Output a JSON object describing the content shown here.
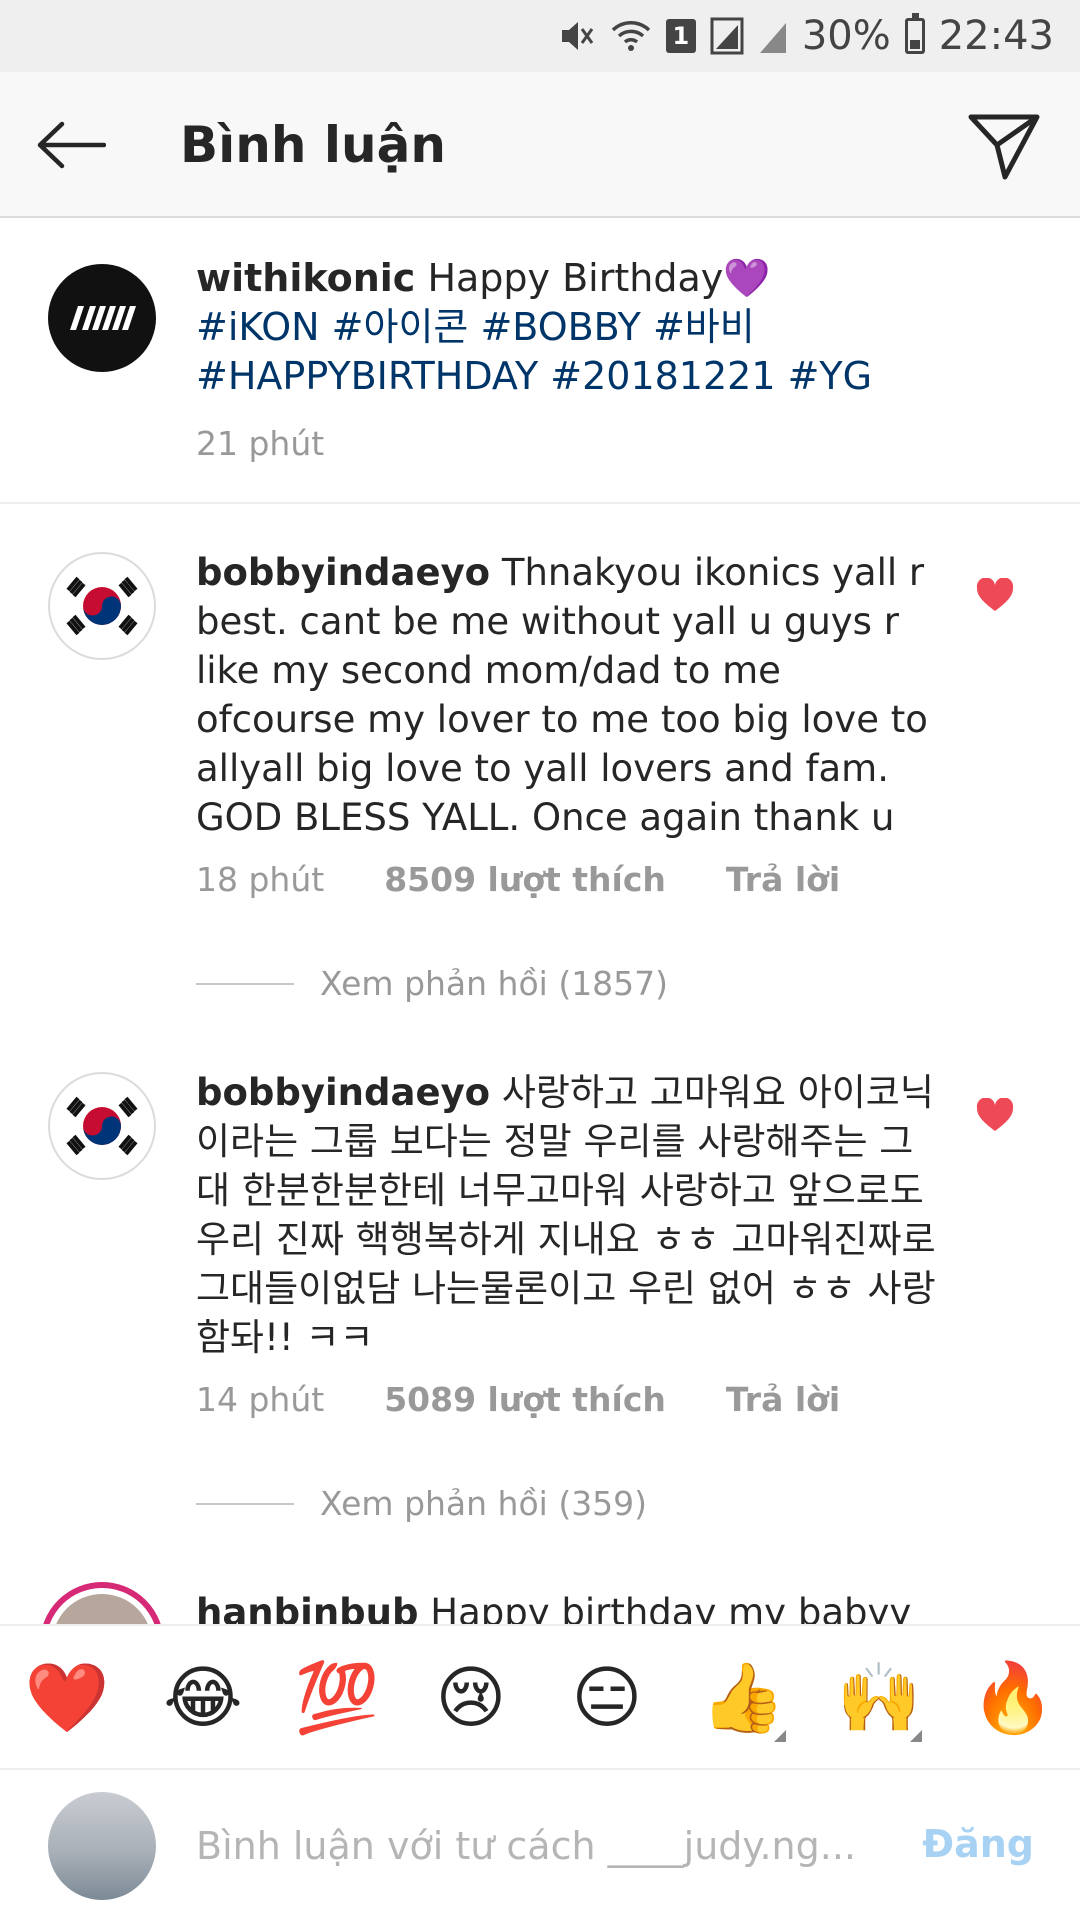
{
  "status_bar": {
    "battery": "30%",
    "sim_slot": "1",
    "time": "22:43"
  },
  "header": {
    "title": "Bình luận"
  },
  "caption": {
    "username": "withikonic",
    "text": "Happy Birthday💜",
    "hashtags": "#iKON #아이콘 #BOBBY #바비 #HAPPYBIRTHDAY #20181221 #YG",
    "time": "21 phút"
  },
  "comments": [
    {
      "username": "bobbyindaeyo",
      "text": "Thnakyou ikonics yall r best. cant be me without yall u guys r like my second mom/dad to me ofcourse my lover to me too big love to allyall big love to yall lovers and fam. GOD BLESS YALL. Once again thank u",
      "time": "18 phút",
      "likes": "8509 lượt thích",
      "reply": "Trả lời",
      "view_replies": "Xem phản hồi (1857)"
    },
    {
      "username": "bobbyindaeyo",
      "text": "사랑하고 고마워요 아이코닉 이라는 그룹 보다는 정말 우리를 사랑해주는 그대 한분한분한테 너무고마워 사랑하고 앞으로도 우리 진짜 핵행복하게 지내요 ㅎㅎ 고마워진짜로 그대들이없담 나는물론이고 우린 없어 ㅎㅎ 사랑함돠!! ㅋㅋ",
      "time": "14 phút",
      "likes": "5089 lượt thích",
      "reply": "Trả lời",
      "view_replies": "Xem phản hồi (359)"
    },
    {
      "username": "hanbinbub",
      "text": "Happy birthday my babyy 🐳"
    }
  ],
  "emoji_bar": [
    "❤️",
    "😂",
    "💯",
    "😢",
    "😑",
    "👍",
    "🙌",
    "🔥"
  ],
  "input": {
    "placeholder": "Bình luận với tư cách ____judy.ng...",
    "post_label": "Đăng"
  },
  "colors": {
    "hashtag": "#003569",
    "like_heart": "#ed4956",
    "post_disabled": "#a8d2f3",
    "story_ring": "#d62976"
  }
}
